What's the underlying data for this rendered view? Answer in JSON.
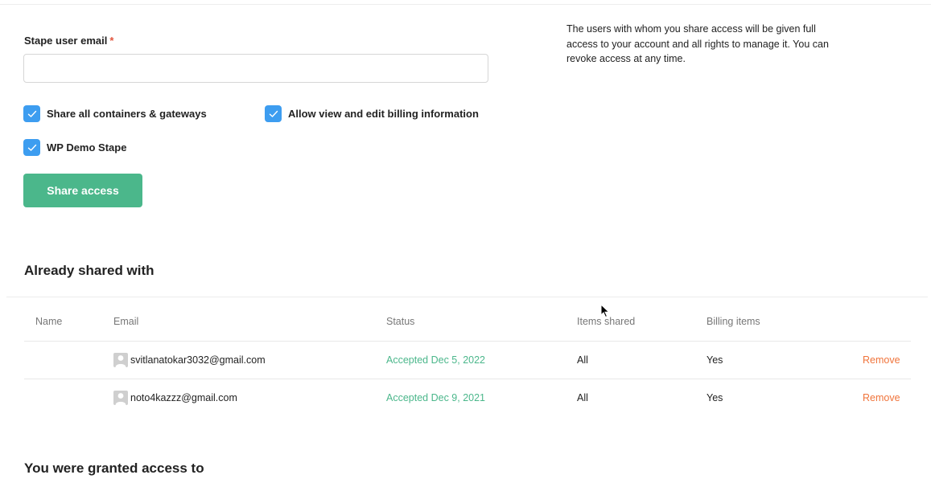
{
  "form": {
    "email_label": "Stape user email",
    "required_mark": "*",
    "email_value": "",
    "email_placeholder": ""
  },
  "options": [
    {
      "label": "Share all containers & gateways",
      "checked": true
    },
    {
      "label": "Allow view and edit billing information",
      "checked": true
    },
    {
      "label": "WP Demo Stape",
      "checked": true
    }
  ],
  "share_button": "Share access",
  "info_text": "The users with whom you share access will be given full access to your account and all rights to manage it. You can revoke access at any time.",
  "shared_section": {
    "title": "Already shared with",
    "columns": [
      "Name",
      "Email",
      "Status",
      "Items shared",
      "Billing items"
    ],
    "rows": [
      {
        "name": "",
        "email": "svitlanatokar3032@gmail.com",
        "status": "Accepted Dec 5, 2022",
        "items_shared": "All",
        "billing_items": "Yes",
        "action": "Remove"
      },
      {
        "name": "",
        "email": "noto4kazzz@gmail.com",
        "status": "Accepted Dec 9, 2021",
        "items_shared": "All",
        "billing_items": "Yes",
        "action": "Remove"
      }
    ]
  },
  "granted_section": {
    "title": "You were granted access to"
  },
  "colors": {
    "accent_green": "#4bb78b",
    "checkbox_blue": "#3d9df0",
    "remove_orange": "#f0743b"
  }
}
